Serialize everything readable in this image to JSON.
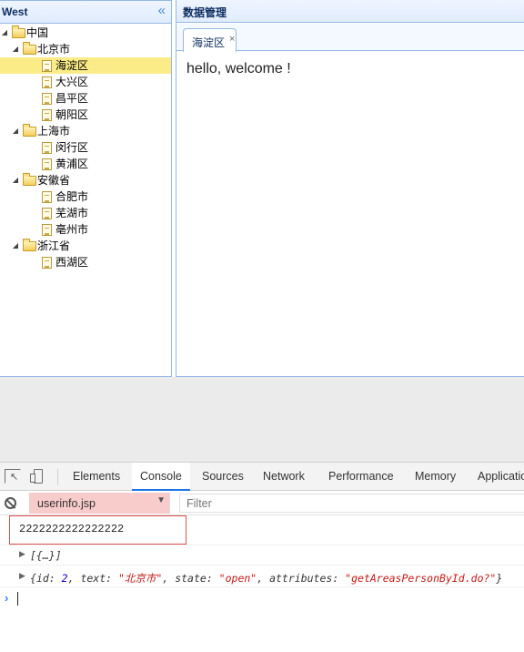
{
  "west_panel": {
    "title": "West",
    "collapse_icon": "double-chevron-left-icon"
  },
  "tree": [
    {
      "label": "中国",
      "level": 0,
      "type": "folder",
      "expanded": true
    },
    {
      "label": "北京市",
      "level": 1,
      "type": "folder",
      "expanded": true
    },
    {
      "label": "海淀区",
      "level": 2,
      "type": "file",
      "selected": true
    },
    {
      "label": "大兴区",
      "level": 2,
      "type": "file"
    },
    {
      "label": "昌平区",
      "level": 2,
      "type": "file"
    },
    {
      "label": "朝阳区",
      "level": 2,
      "type": "file"
    },
    {
      "label": "上海市",
      "level": 1,
      "type": "folder",
      "expanded": true
    },
    {
      "label": "闵行区",
      "level": 2,
      "type": "file"
    },
    {
      "label": "黄浦区",
      "level": 2,
      "type": "file"
    },
    {
      "label": "安徽省",
      "level": 1,
      "type": "folder",
      "expanded": true
    },
    {
      "label": "合肥市",
      "level": 2,
      "type": "file"
    },
    {
      "label": "芜湖市",
      "level": 2,
      "type": "file"
    },
    {
      "label": "亳州市",
      "level": 2,
      "type": "file"
    },
    {
      "label": "浙江省",
      "level": 1,
      "type": "folder",
      "expanded": true
    },
    {
      "label": "西湖区",
      "level": 2,
      "type": "file"
    }
  ],
  "center_panel": {
    "title": "数据管理",
    "tab": {
      "label": "海淀区",
      "close": "×"
    },
    "content": "hello, welcome !"
  },
  "devtools": {
    "tabs": [
      "Elements",
      "Console",
      "Sources",
      "Network",
      "Performance",
      "Memory",
      "Applicatio"
    ],
    "active_tab": "Console",
    "context": "userinfo.jsp",
    "filter_placeholder": "Filter",
    "console": {
      "log": "2222222222222222",
      "array_preview": "[{…}]",
      "object_preview": {
        "open": "{",
        "k1": "id: ",
        "v1": "2",
        "sep1": ", ",
        "k2": "text: ",
        "v2": "\"北京市\"",
        "sep2": ", ",
        "k3": "state: ",
        "v3": "\"open\"",
        "sep3": ", ",
        "k4": "attributes: ",
        "v4": "\"getAreasPersonById.do?\"",
        "close": "}"
      },
      "prompt": "›"
    }
  },
  "colors": {
    "panel_border": "#95b8e7",
    "selected_node": "#fbec88",
    "active_tab_underline": "#1a73e8",
    "context_highlight": "#f9cccc",
    "highlight_box": "#e05050"
  }
}
